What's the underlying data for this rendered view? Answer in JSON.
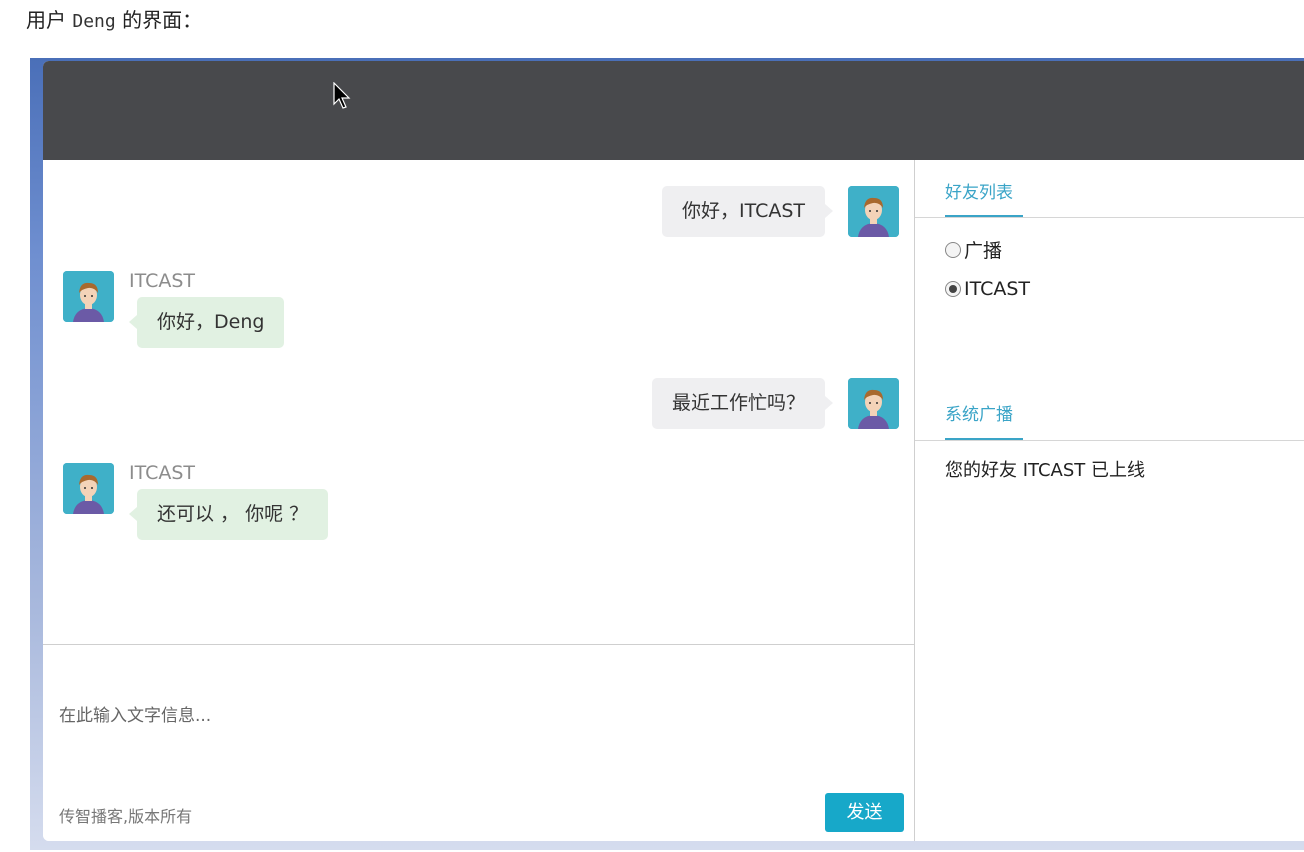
{
  "caption": {
    "prefix": "用户",
    "user": "Deng",
    "suffix": "的界面："
  },
  "messages": [
    {
      "side": "right",
      "text": "你好，ITCAST"
    },
    {
      "side": "left",
      "sender": "ITCAST",
      "text": "你好，Deng"
    },
    {
      "side": "right",
      "text": "最近工作忙吗？"
    },
    {
      "side": "left",
      "sender": "ITCAST",
      "text": "还可以 ， 你呢 ？"
    }
  ],
  "input": {
    "placeholder": "在此输入文字信息...",
    "copyright": "传智播客,版本所有",
    "send_label": "发送"
  },
  "sidebar": {
    "friends_title": "好友列表",
    "friends": [
      {
        "label": "广播",
        "checked": false
      },
      {
        "label": "ITCAST",
        "checked": true
      }
    ],
    "broadcast_title": "系统广播",
    "broadcast_message": "您的好友 ITCAST 已上线"
  },
  "colors": {
    "accent": "#3aa4c7",
    "send_button": "#17a8c9",
    "topbar": "#48494c",
    "bubble_mine": "#efeff1",
    "bubble_theirs": "#e1f1e2"
  }
}
